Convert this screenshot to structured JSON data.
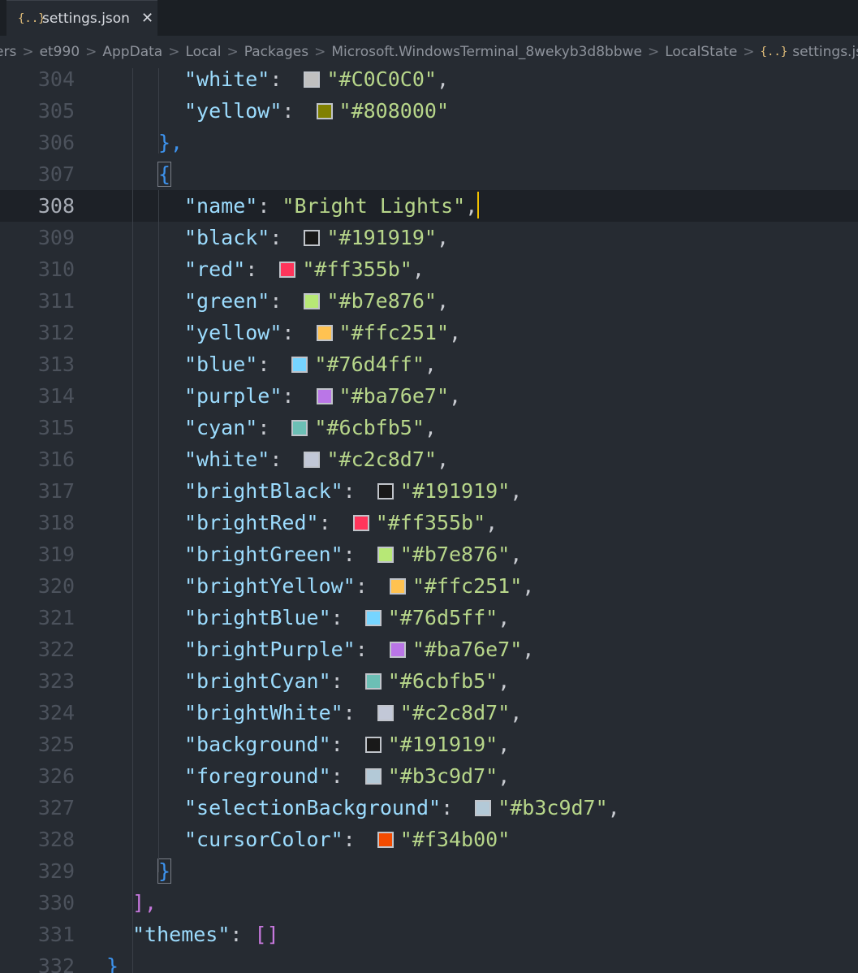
{
  "tab": {
    "icon": "json-icon",
    "title": "settings.json"
  },
  "breadcrumb": [
    "ers",
    "et990",
    "AppData",
    "Local",
    "Packages",
    "Microsoft.WindowsTerminal_8wekyb3d8bbwe",
    "LocalState"
  ],
  "breadcrumb_file": "settings.json",
  "breadcrumb_tail": "[ ]",
  "active_line": 308,
  "lines": [
    {
      "n": "304",
      "key": "\"white\"",
      "color": "#C0C0C0",
      "val": "\"#C0C0C0\"",
      "tail": ","
    },
    {
      "n": "305",
      "key": "\"yellow\"",
      "color": "#808000",
      "val": "\"#808000\"",
      "tail": ""
    },
    {
      "n": "306",
      "text": "},"
    },
    {
      "n": "307",
      "text": "{"
    },
    {
      "n": "308",
      "key": "\"name\"",
      "val": "\"Bright Lights\"",
      "tail": ","
    },
    {
      "n": "309",
      "key": "\"black\"",
      "color": "#191919",
      "val": "\"#191919\"",
      "tail": ","
    },
    {
      "n": "310",
      "key": "\"red\"",
      "color": "#ff355b",
      "val": "\"#ff355b\"",
      "tail": ","
    },
    {
      "n": "311",
      "key": "\"green\"",
      "color": "#b7e876",
      "val": "\"#b7e876\"",
      "tail": ","
    },
    {
      "n": "312",
      "key": "\"yellow\"",
      "color": "#ffc251",
      "val": "\"#ffc251\"",
      "tail": ","
    },
    {
      "n": "313",
      "key": "\"blue\"",
      "color": "#76d4ff",
      "val": "\"#76d4ff\"",
      "tail": ","
    },
    {
      "n": "314",
      "key": "\"purple\"",
      "color": "#ba76e7",
      "val": "\"#ba76e7\"",
      "tail": ","
    },
    {
      "n": "315",
      "key": "\"cyan\"",
      "color": "#6cbfb5",
      "val": "\"#6cbfb5\"",
      "tail": ","
    },
    {
      "n": "316",
      "key": "\"white\"",
      "color": "#c2c8d7",
      "val": "\"#c2c8d7\"",
      "tail": ","
    },
    {
      "n": "317",
      "key": "\"brightBlack\"",
      "color": "#191919",
      "val": "\"#191919\"",
      "tail": ","
    },
    {
      "n": "318",
      "key": "\"brightRed\"",
      "color": "#ff355b",
      "val": "\"#ff355b\"",
      "tail": ","
    },
    {
      "n": "319",
      "key": "\"brightGreen\"",
      "color": "#b7e876",
      "val": "\"#b7e876\"",
      "tail": ","
    },
    {
      "n": "320",
      "key": "\"brightYellow\"",
      "color": "#ffc251",
      "val": "\"#ffc251\"",
      "tail": ","
    },
    {
      "n": "321",
      "key": "\"brightBlue\"",
      "color": "#76d5ff",
      "val": "\"#76d5ff\"",
      "tail": ","
    },
    {
      "n": "322",
      "key": "\"brightPurple\"",
      "color": "#ba76e7",
      "val": "\"#ba76e7\"",
      "tail": ","
    },
    {
      "n": "323",
      "key": "\"brightCyan\"",
      "color": "#6cbfb5",
      "val": "\"#6cbfb5\"",
      "tail": ","
    },
    {
      "n": "324",
      "key": "\"brightWhite\"",
      "color": "#c2c8d7",
      "val": "\"#c2c8d7\"",
      "tail": ","
    },
    {
      "n": "325",
      "key": "\"background\"",
      "color": "#191919",
      "val": "\"#191919\"",
      "tail": ","
    },
    {
      "n": "326",
      "key": "\"foreground\"",
      "color": "#b3c9d7",
      "val": "\"#b3c9d7\"",
      "tail": ","
    },
    {
      "n": "327",
      "key": "\"selectionBackground\"",
      "color": "#b3c9d7",
      "val": "\"#b3c9d7\"",
      "tail": ","
    },
    {
      "n": "328",
      "key": "\"cursorColor\"",
      "color": "#f34b00",
      "val": "\"#f34b00\"",
      "tail": ""
    },
    {
      "n": "329",
      "text": "}"
    },
    {
      "n": "330",
      "text": "],"
    },
    {
      "n": "331",
      "key": "\"themes\"",
      "val": "[]",
      "tail": ""
    },
    {
      "n": "332",
      "text": "}"
    }
  ]
}
